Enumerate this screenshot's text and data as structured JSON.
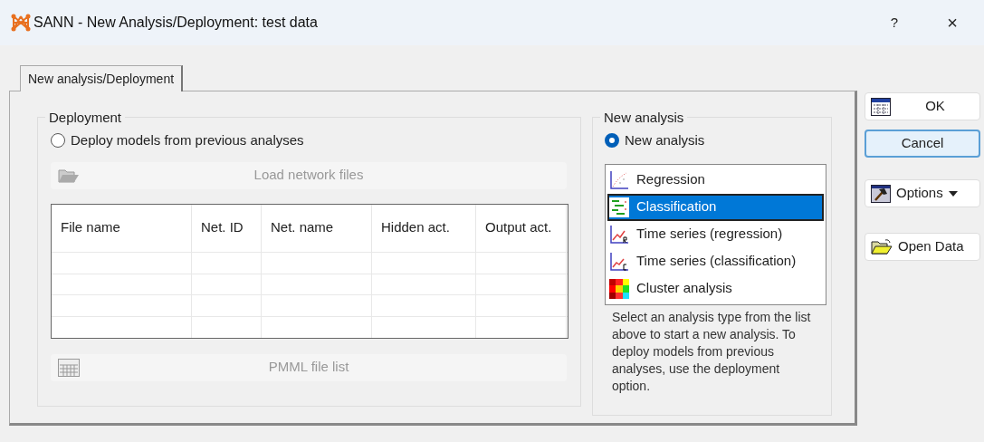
{
  "window": {
    "title": "SANN - New Analysis/Deployment: test data",
    "help": "?",
    "close": "×"
  },
  "tabs": [
    {
      "label": "New analysis/Deployment",
      "selected": true
    }
  ],
  "deployment": {
    "title": "Deployment",
    "radio": {
      "label": "Deploy models from previous analyses",
      "selected": false
    },
    "load_button": {
      "label": "Load network files",
      "disabled": true
    },
    "table": {
      "columns": [
        "File name",
        "Net. ID",
        "Net. name",
        "Hidden act.",
        "Output act."
      ]
    },
    "pmml_button": {
      "label": "PMML file list",
      "disabled": true
    }
  },
  "new_analysis": {
    "title": "New analysis",
    "radio": {
      "label": "New analysis",
      "selected": true
    },
    "items": [
      {
        "label": "Regression",
        "selected": false
      },
      {
        "label": "Classification",
        "selected": true
      },
      {
        "label": "Time series (regression)",
        "selected": false
      },
      {
        "label": "Time series (classification)",
        "selected": false
      },
      {
        "label": "Cluster analysis",
        "selected": false
      }
    ],
    "help_text": "Select an analysis type from the list above to start a new analysis. To deploy models from previous analyses, use the deployment option."
  },
  "buttons": [
    {
      "label": "OK",
      "kind": "ok"
    },
    {
      "label": "Cancel",
      "kind": "cancel"
    },
    {
      "label": "Options",
      "kind": "options"
    },
    {
      "label": "Open Data",
      "kind": "open"
    }
  ]
}
